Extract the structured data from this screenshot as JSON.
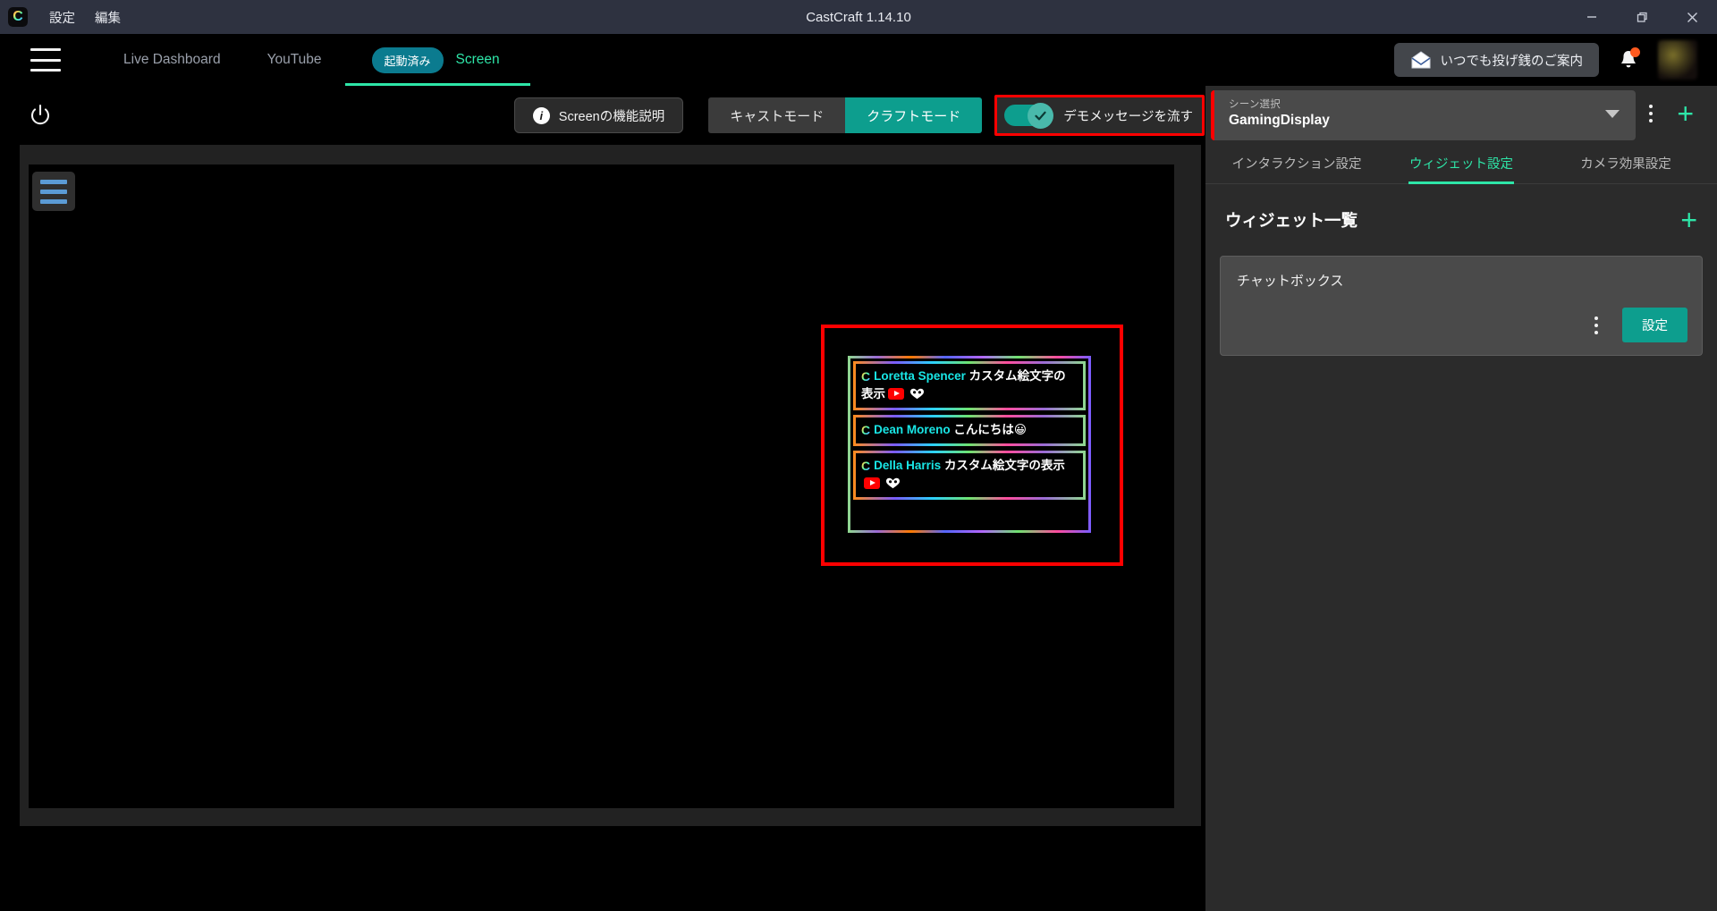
{
  "titlebar": {
    "logo_letter": "C",
    "menu": [
      {
        "label": "設定",
        "name": "menu-settings"
      },
      {
        "label": "編集",
        "name": "menu-edit"
      }
    ],
    "title": "CastCraft 1.14.10",
    "window_buttons": {
      "minimize": "minimize-icon",
      "maximize": "maximize-icon",
      "close": "close-icon"
    }
  },
  "nav": {
    "menu_icon": "hamburger-icon",
    "items": [
      {
        "label": "Live Dashboard",
        "name": "nav-live-dashboard",
        "active": false
      },
      {
        "label": "YouTube",
        "name": "nav-youtube",
        "active": false
      },
      {
        "label": "Screen",
        "name": "nav-screen",
        "active": true
      }
    ],
    "running_badge": "起動済み",
    "tip_button": "いつでも投げ銭のご案内",
    "tip_icon": "mail-open-icon",
    "bell_icon": "bell-icon",
    "avatar": "user-avatar"
  },
  "toolbar": {
    "power_icon": "power-icon",
    "feature_button": "Screenの機能説明",
    "info_icon": "info-icon",
    "modes": [
      {
        "label": "キャストモード",
        "active": false
      },
      {
        "label": "クラフトモード",
        "active": true
      }
    ],
    "demo_toggle_label": "デモメッセージを流す",
    "demo_toggle_on": true,
    "highlight_color": "#ff0000",
    "accent_color": "#0d9e8e"
  },
  "preview": {
    "menu_icon": "hamburger-icon",
    "selection_color": "#ff0000",
    "chat_messages": [
      {
        "platform_icon": "castcraft-icon",
        "username": "Loretta Spencer",
        "text": "カスタム絵文字の表示",
        "badges": [
          "youtube-badge",
          "heart-hands-badge"
        ]
      },
      {
        "platform_icon": "castcraft-icon",
        "username": "Dean Moreno",
        "text": "こんにちは😀",
        "badges": []
      },
      {
        "platform_icon": "castcraft-icon",
        "username": "Della Harris",
        "text": "カスタム絵文字の表示",
        "badges": [
          "youtube-badge",
          "heart-hands-badge"
        ]
      }
    ]
  },
  "right_panel": {
    "scene": {
      "label": "シーン選択",
      "value": "GamingDisplay",
      "caret_icon": "chevron-down-icon",
      "kebab_icon": "more-vertical-icon",
      "add_icon": "plus-icon"
    },
    "tabs": [
      {
        "label": "インタラクション設定",
        "active": false
      },
      {
        "label": "ウィジェット設定",
        "active": true
      },
      {
        "label": "カメラ効果設定",
        "active": false
      }
    ],
    "widget_section": {
      "title": "ウィジェット一覧",
      "add_icon": "plus-icon",
      "items": [
        {
          "title": "チャットボックス",
          "kebab_icon": "more-vertical-icon",
          "settings_label": "設定"
        }
      ]
    }
  },
  "colors": {
    "teal": "#0d9e8e",
    "mint": "#2ee6a8",
    "red_highlight": "#ff0000",
    "titlebar": "#2e3240",
    "panel": "#2b2b2b"
  }
}
